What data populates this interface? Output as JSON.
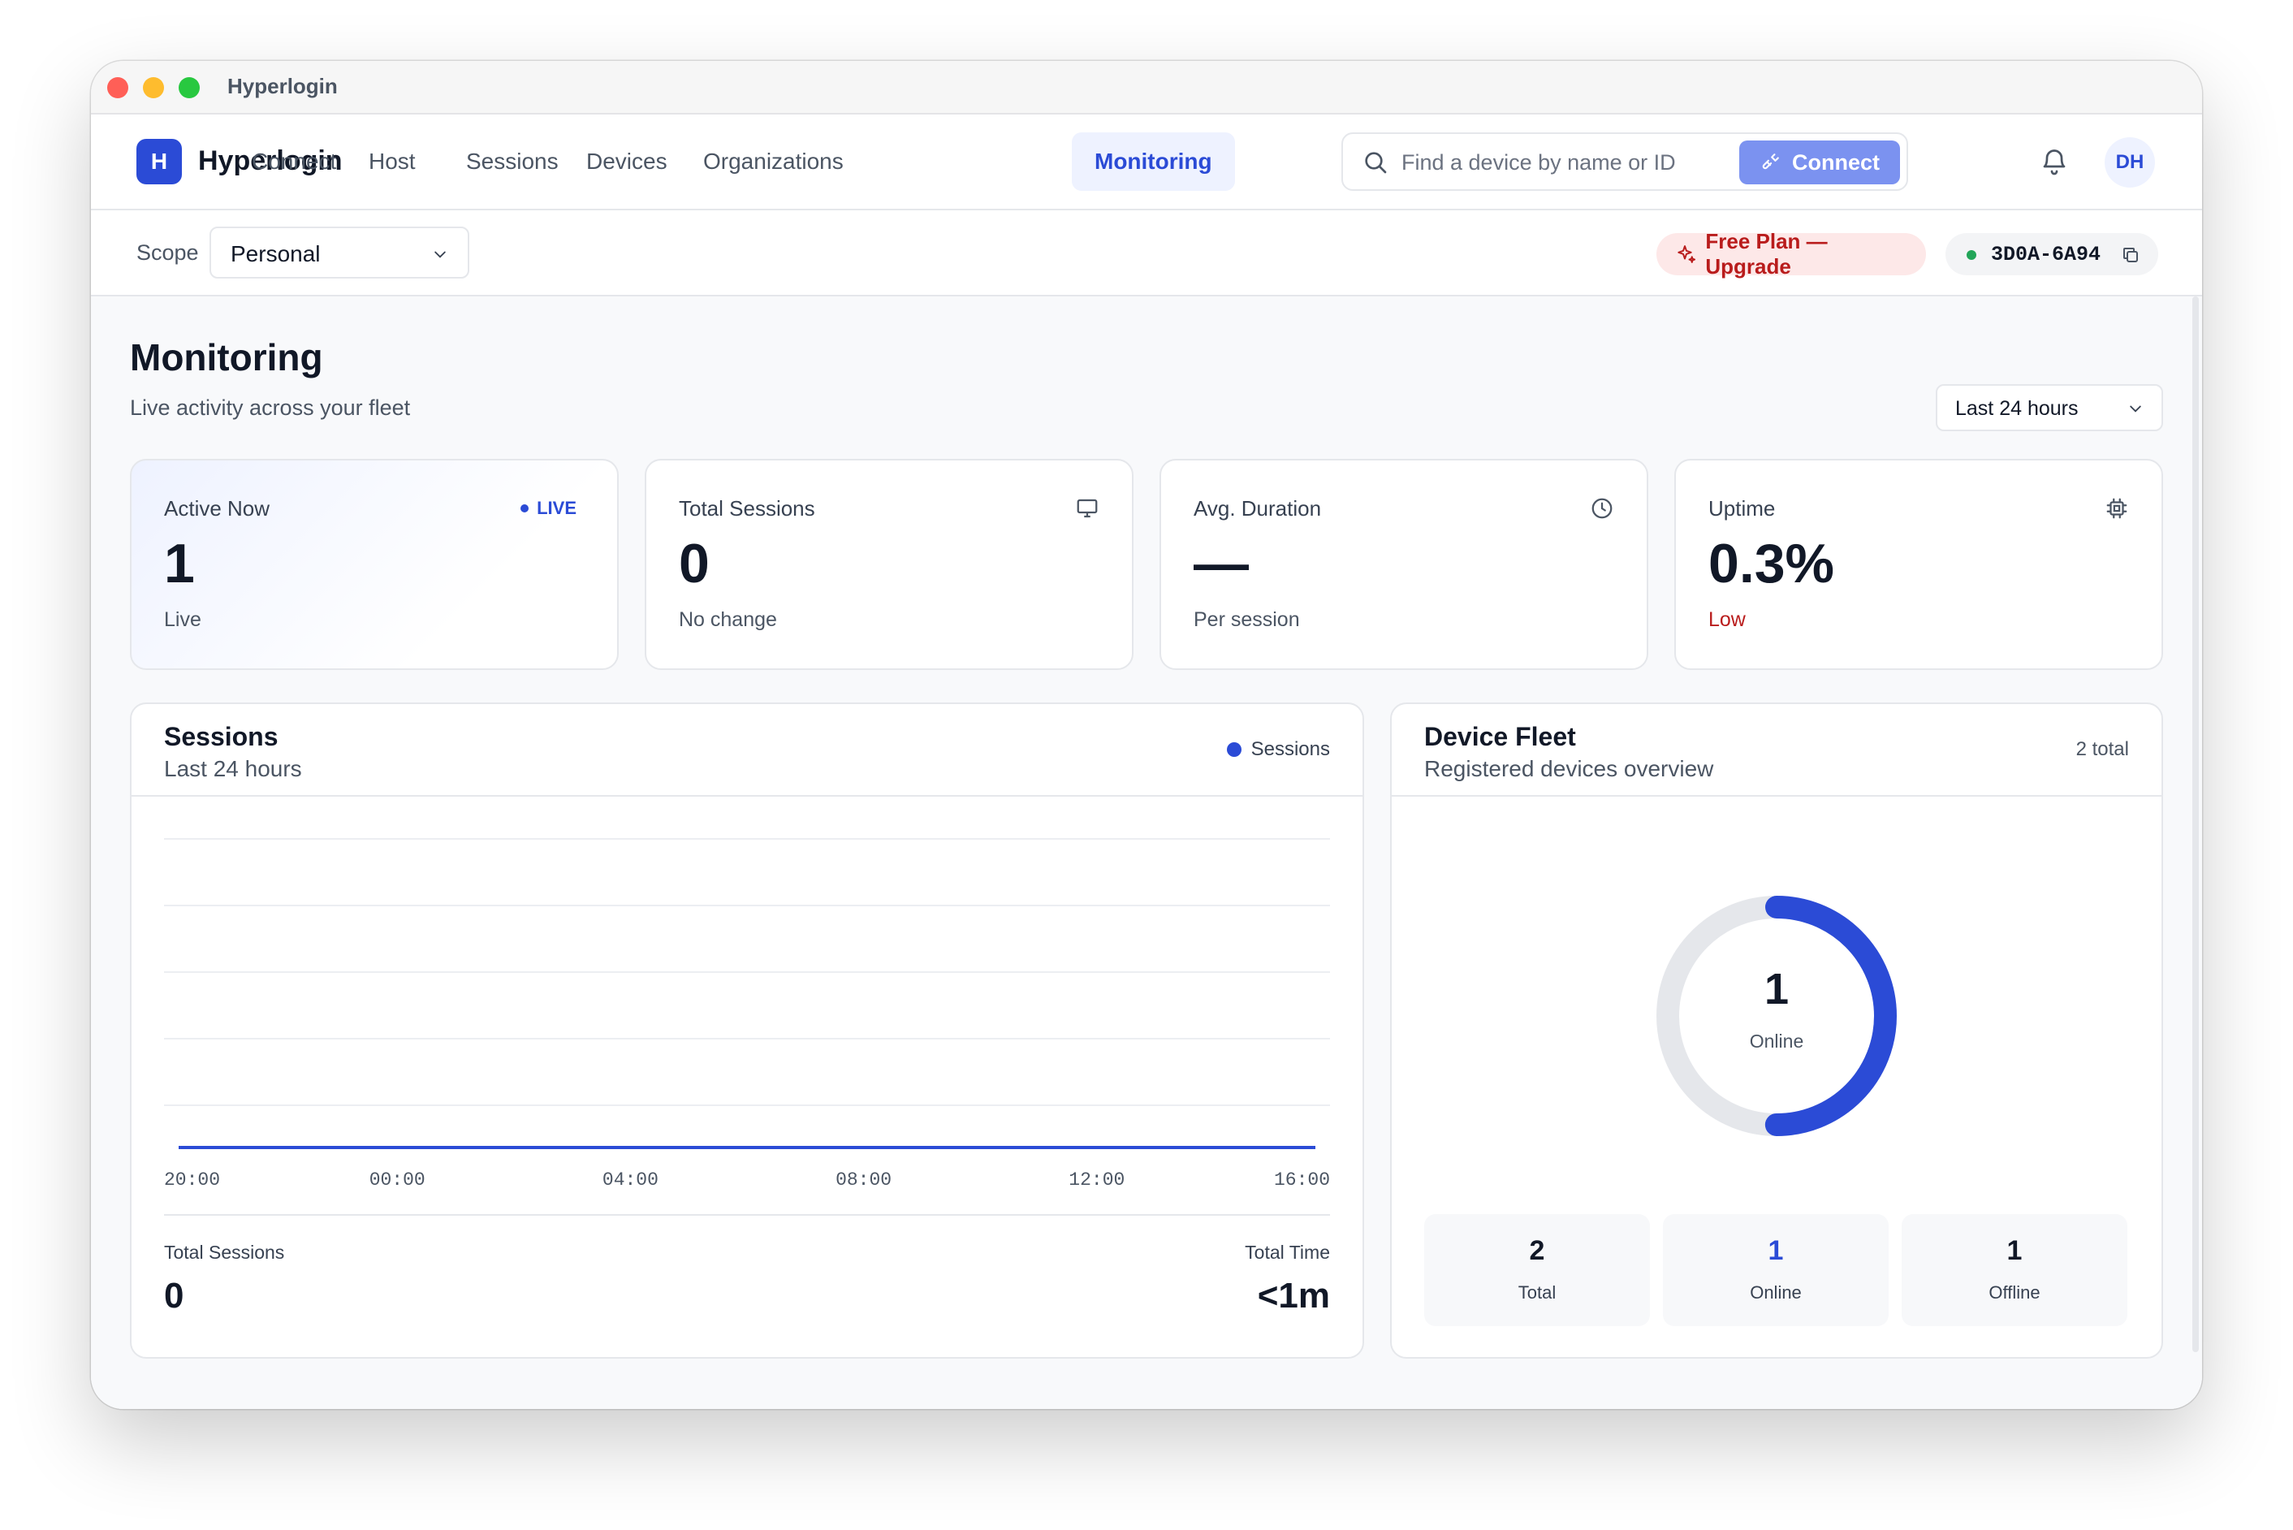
{
  "window": {
    "title": "Hyperlogin"
  },
  "nav": {
    "brand_initial": "H",
    "brand": "Hyperlogin",
    "items": [
      {
        "label": "Connect"
      },
      {
        "label": "Host"
      },
      {
        "label": "Sessions"
      },
      {
        "label": "Devices"
      },
      {
        "label": "Organizations"
      },
      {
        "label": "Monitoring",
        "active": true
      }
    ],
    "search_placeholder": "Find a device by name or ID",
    "connect_label": "Connect",
    "avatar_initials": "DH"
  },
  "subbar": {
    "scope_label": "Scope",
    "scope_value": "Personal",
    "plan_badge": "Free Plan — Upgrade",
    "device_id": "3D0A-6A94"
  },
  "page": {
    "title": "Monitoring",
    "subtitle": "Live activity across your fleet",
    "range": "Last 24 hours"
  },
  "stats": [
    {
      "label": "Active Now",
      "value": "1",
      "foot": "Live",
      "tag": "LIVE"
    },
    {
      "label": "Total Sessions",
      "value": "0",
      "foot": "No change",
      "icon": "monitor-icon"
    },
    {
      "label": "Avg. Duration",
      "value": "—",
      "foot": "Per session",
      "icon": "clock-icon"
    },
    {
      "label": "Uptime",
      "value": "0.3%",
      "foot": "Low",
      "icon": "cpu-icon"
    }
  ],
  "sessions_panel": {
    "title": "Sessions",
    "subtitle": "Last 24 hours",
    "legend": "Sessions",
    "total_sessions_label": "Total Sessions",
    "total_sessions_value": "0",
    "total_time_label": "Total Time",
    "total_time_value": "<1m"
  },
  "chart_data": {
    "type": "line",
    "x": [
      "20:00",
      "00:00",
      "04:00",
      "08:00",
      "12:00",
      "16:00"
    ],
    "series": [
      {
        "name": "Sessions",
        "values": [
          0,
          0,
          0,
          0,
          0,
          0
        ]
      }
    ],
    "xlabel": "",
    "ylabel": "",
    "grid": true,
    "legend": "top-right",
    "color": "#2b4bd6"
  },
  "fleet": {
    "title": "Device Fleet",
    "subtitle": "Registered devices overview",
    "total_label": "2 total",
    "donut_value": "1",
    "donut_label": "Online",
    "online_fraction": 0.5,
    "boxes": [
      {
        "value": "2",
        "label": "Total"
      },
      {
        "value": "1",
        "label": "Online"
      },
      {
        "value": "1",
        "label": "Offline"
      }
    ]
  },
  "colors": {
    "accent": "#2b4bd6",
    "danger": "#b91c1c",
    "success": "#22a559"
  }
}
